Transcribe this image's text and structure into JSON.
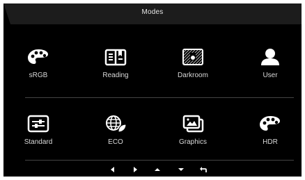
{
  "osd": {
    "title": "Modes"
  },
  "modes": [
    {
      "label": "sRGB",
      "icon": "palette-icon"
    },
    {
      "label": "Reading",
      "icon": "book-icon"
    },
    {
      "label": "Darkroom",
      "icon": "darkroom-icon"
    },
    {
      "label": "User",
      "icon": "user-icon"
    },
    {
      "label": "Standard",
      "icon": "sliders-icon"
    },
    {
      "label": "ECO",
      "icon": "eco-globe-icon"
    },
    {
      "label": "Graphics",
      "icon": "graphics-icon"
    },
    {
      "label": "HDR",
      "icon": "palette-icon"
    }
  ],
  "nav": [
    "left-arrow-icon",
    "right-arrow-icon",
    "up-arrow-icon",
    "down-arrow-icon",
    "back-icon"
  ],
  "colors": {
    "background": "#000000",
    "titlebar": "#1c1c1c",
    "text": "#d9d9d9",
    "icon": "#ffffff"
  }
}
